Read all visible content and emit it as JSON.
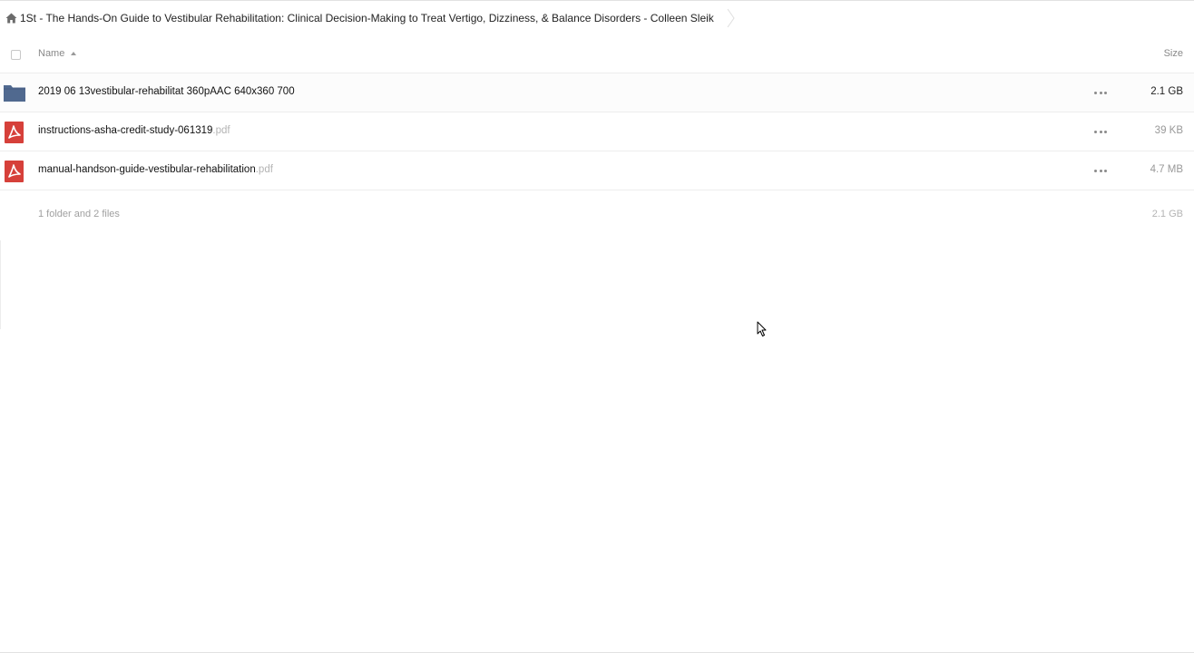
{
  "breadcrumb": {
    "path": "1St - The Hands-On Guide to Vestibular Rehabilitation: Clinical Decision-Making to Treat Vertigo, Dizziness, & Balance Disorders - Colleen Sleik",
    "home_icon": "home-icon"
  },
  "table": {
    "columns": {
      "name": "Name",
      "size": "Size"
    },
    "rows": [
      {
        "type": "folder",
        "name": "2019 06 13vestibular-rehabilitat 360pAAC 640x360 700",
        "ext": "",
        "size": "2.1 GB",
        "icon": "folder-icon"
      },
      {
        "type": "pdf",
        "name": "instructions-asha-credit-study-061319",
        "ext": "pdf",
        "size": "39 KB",
        "icon": "pdf-icon"
      },
      {
        "type": "pdf",
        "name": "manual-handson-guide-vestibular-rehabilitation",
        "ext": "pdf",
        "size": "4.7 MB",
        "icon": "pdf-icon"
      }
    ],
    "summary": {
      "text": "1 folder and 2 files",
      "size": "2.1 GB"
    }
  },
  "colors": {
    "folder": "#50698f",
    "pdf": "#d6403a",
    "border": "#ededed"
  }
}
